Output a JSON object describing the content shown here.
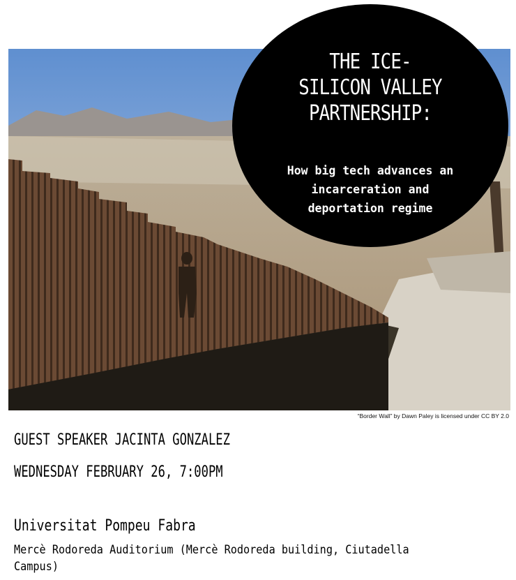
{
  "poster": {
    "title_lines": [
      "THE ICE-",
      "SILICON VALLEY",
      "PARTNERSHIP:"
    ],
    "subtitle_lines": [
      "How big tech advances an",
      "incarceration and",
      "deportation regime"
    ],
    "photo_credit": "“Border Wall” by Dawn Paley is licensed under CC BY 2.0",
    "speaker": "GUEST SPEAKER JACINTA GONZALEZ",
    "date_time": "WEDNESDAY FEBRUARY 26, 7:00PM",
    "venue": "Universitat Pompeu Fabra",
    "room_lines": [
      "Mercè Rodoreda Auditorium (Mercè Rodoreda building, Ciutadella",
      "Campus)"
    ]
  },
  "colors": {
    "circle": "#000000",
    "sky_top": "#5f8fd0",
    "sky_bottom": "#c7d6ea",
    "wall": "#6b4a34",
    "ground": "#b9a588"
  }
}
